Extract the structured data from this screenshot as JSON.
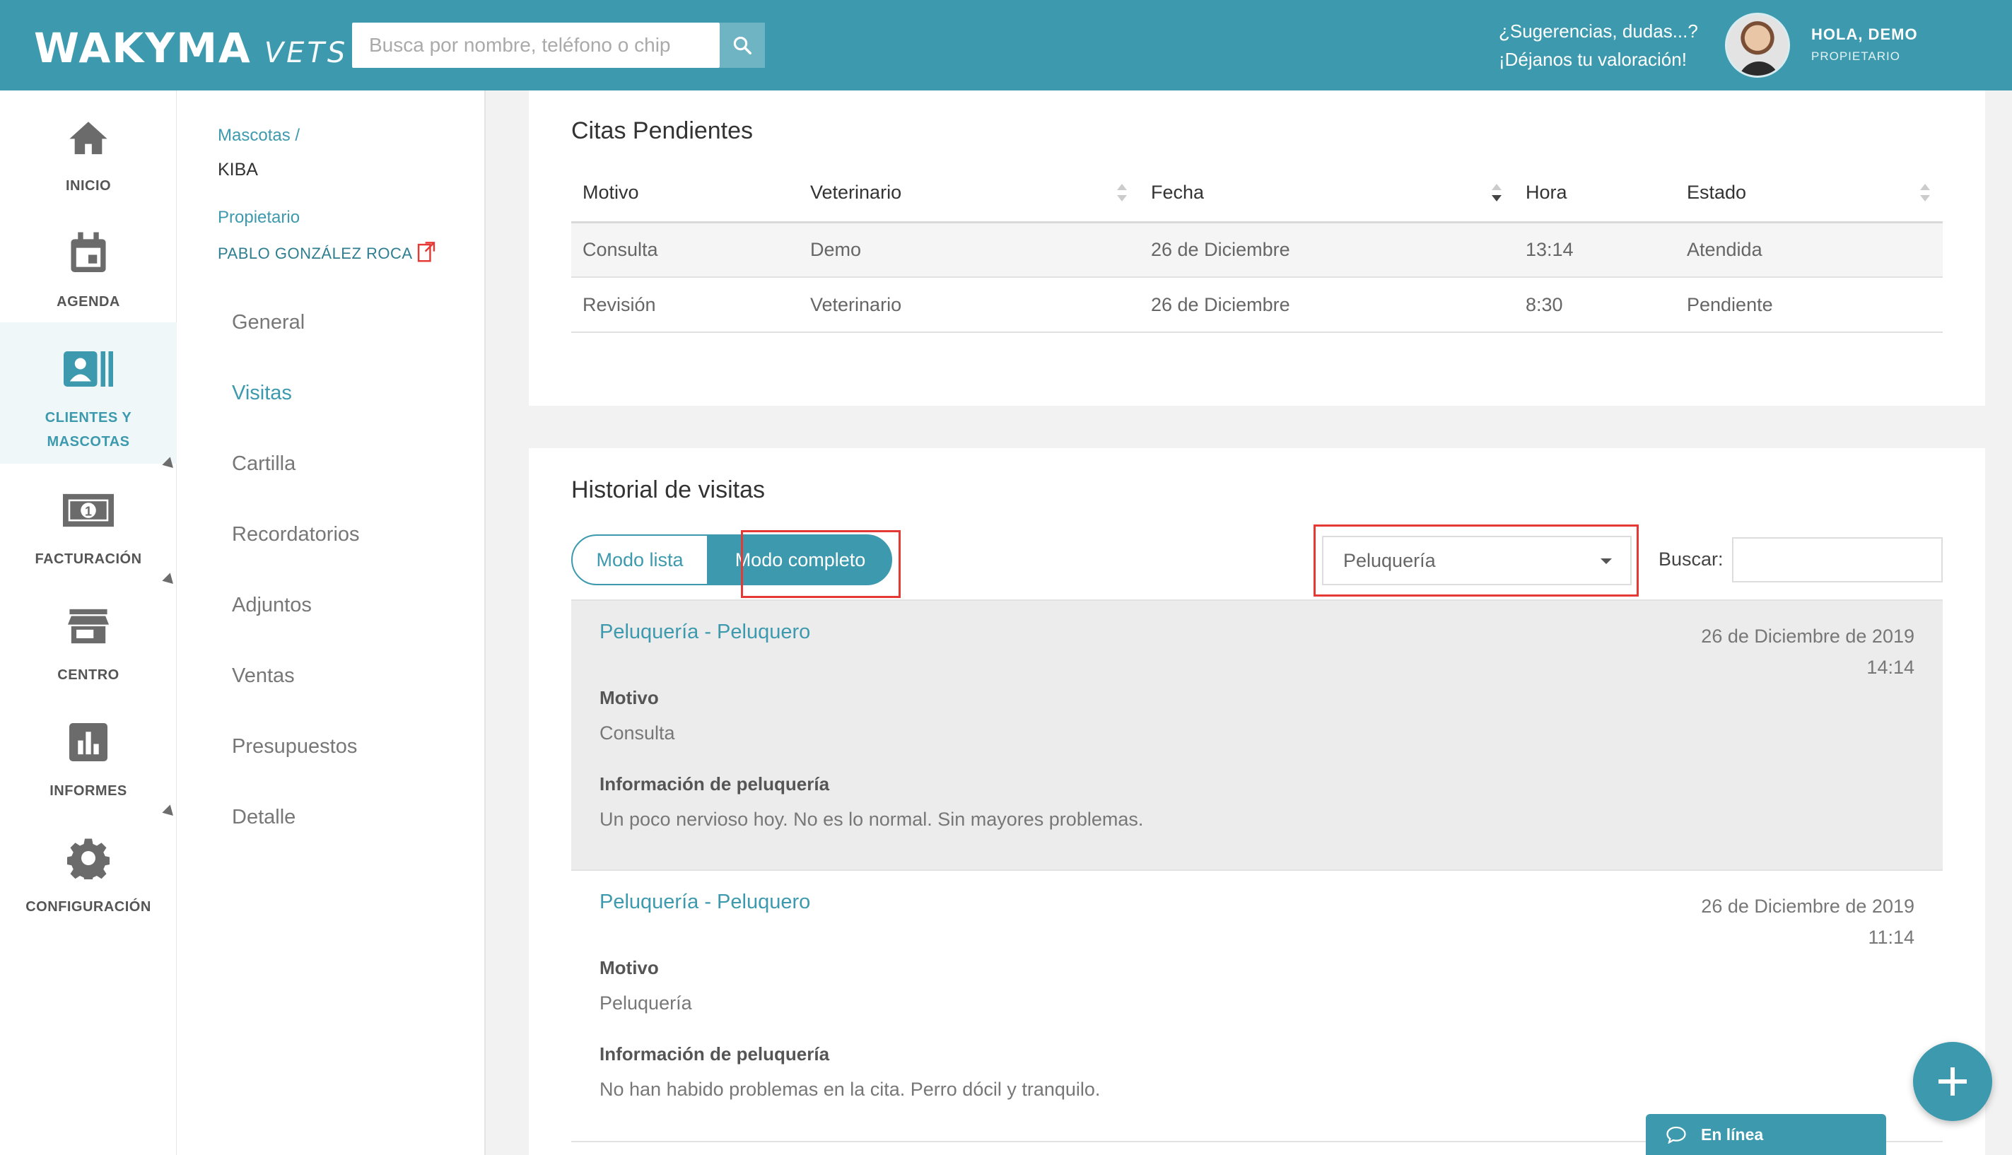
{
  "header": {
    "logo_main": "WAKYMA",
    "logo_sub": "VETS",
    "search_placeholder": "Busca por nombre, teléfono o chip",
    "feedback_line1": "¿Sugerencias, dudas...?",
    "feedback_line2": "¡Déjanos tu valoración!",
    "user_greeting": "HOLA, DEMO",
    "user_role": "PROPIETARIO"
  },
  "leftnav": {
    "items": [
      {
        "label": "INICIO",
        "icon": "home-icon"
      },
      {
        "label": "AGENDA",
        "icon": "calendar-icon"
      },
      {
        "label": "CLIENTES Y MASCOTAS",
        "label_line1": "CLIENTES Y",
        "label_line2": "MASCOTAS",
        "icon": "contacts-icon",
        "active": true
      },
      {
        "label": "FACTURACIÓN",
        "icon": "money-icon"
      },
      {
        "label": "CENTRO",
        "icon": "store-icon"
      },
      {
        "label": "INFORMES",
        "icon": "bar-chart-icon"
      },
      {
        "label": "CONFIGURACIÓN",
        "icon": "gear-icon"
      }
    ]
  },
  "subnav": {
    "breadcrumb_link": "Mascotas /",
    "pet_name": "KIBA",
    "owner_label": "Propietario",
    "owner_name": "PABLO GONZÁLEZ ROCA",
    "items": [
      "General",
      "Visitas",
      "Cartilla",
      "Recordatorios",
      "Adjuntos",
      "Ventas",
      "Presupuestos",
      "Detalle"
    ],
    "active_item": "Visitas"
  },
  "citas": {
    "title": "Citas Pendientes",
    "columns": [
      "Motivo",
      "Veterinario",
      "Fecha",
      "Hora",
      "Estado"
    ],
    "rows": [
      [
        "Consulta",
        "Demo",
        "26 de Diciembre",
        "13:14",
        "Atendida"
      ],
      [
        "Revisión",
        "Veterinario",
        "26 de Diciembre",
        "8:30",
        "Pendiente"
      ]
    ]
  },
  "historial": {
    "title": "Historial de visitas",
    "mode_list_label": "Modo lista",
    "mode_full_label": "Modo completo",
    "filter_value": "Peluquería",
    "search_label": "Buscar:",
    "visits": [
      {
        "title": "Peluquería - Peluquero",
        "date": "26 de Diciembre de 2019",
        "time": "14:14",
        "motivo_label": "Motivo",
        "motivo": "Consulta",
        "info_label": "Información de peluquería",
        "info": "Un poco nervioso hoy. No es lo normal. Sin mayores problemas."
      },
      {
        "title": "Peluquería - Peluquero",
        "date": "26 de Diciembre de 2019",
        "time": "11:14",
        "motivo_label": "Motivo",
        "motivo": "Peluquería",
        "info_label": "Información de peluquería",
        "info": "No han habido problemas en la cita. Perro dócil y tranquilo."
      }
    ]
  },
  "chat": {
    "label": "En línea"
  },
  "colors": {
    "brand": "#3d9aae",
    "highlight": "#e53935"
  }
}
